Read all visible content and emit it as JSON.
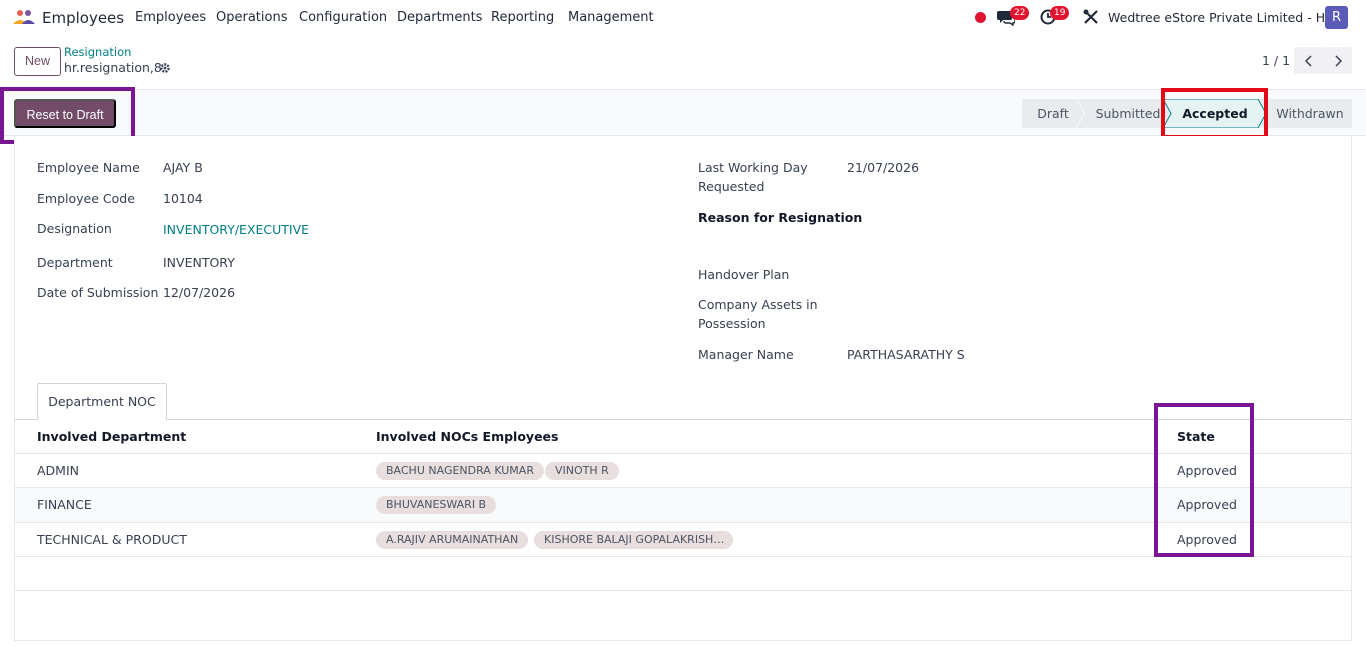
{
  "navbar": {
    "app_name": "Employees",
    "menus": [
      "Employees",
      "Operations",
      "Configuration",
      "Departments",
      "Reporting",
      "Management"
    ],
    "messages_count": "22",
    "activities_count": "19",
    "company": "Wedtree eStore Private Limited - HO",
    "avatar_letter": "R"
  },
  "control": {
    "new_label": "New",
    "breadcrumb_parent": "Resignation",
    "breadcrumb_current": "hr.resignation,8",
    "pager": "1 / 1"
  },
  "statusbar": {
    "reset_label": "Reset to Draft",
    "stages": [
      "Draft",
      "Submitted",
      "Accepted",
      "Withdrawn"
    ],
    "active_stage": "Accepted"
  },
  "form": {
    "left": [
      {
        "label": "Employee Name",
        "value": "AJAY B"
      },
      {
        "label": "Employee Code",
        "value": "10104"
      },
      {
        "label": "Designation",
        "value": "INVENTORY/EXECUTIVE"
      },
      {
        "label": "Department",
        "value": "INVENTORY"
      },
      {
        "label": "Date of Submission",
        "value": "12/07/2026"
      }
    ],
    "right": {
      "last_working_label_1": "Last Working Day",
      "last_working_label_2": "Requested",
      "last_working_value": "21/07/2026",
      "reason_label": "Reason for Resignation",
      "handover_label": "Handover Plan",
      "assets_label_1": "Company Assets in",
      "assets_label_2": "Possession",
      "manager_label": "Manager Name",
      "manager_value": "PARTHASARATHY S"
    }
  },
  "noc": {
    "tab_label": "Department NOC",
    "columns": [
      "Involved Department",
      "Involved NOCs Employees",
      "State"
    ],
    "rows": [
      {
        "department": "ADMIN",
        "employees": [
          "BACHU NAGENDRA KUMAR",
          "VINOTH R"
        ],
        "state": "Approved"
      },
      {
        "department": "FINANCE",
        "employees": [
          "BHUVANESWARI B"
        ],
        "state": "Approved"
      },
      {
        "department": "TECHNICAL & PRODUCT",
        "employees": [
          "A.RAJIV ARUMAINATHAN",
          "KISHORE BALAJI GOPALAKRISH…"
        ],
        "state": "Approved"
      }
    ]
  },
  "colors": {
    "primary": "#714b67",
    "link": "#017e84",
    "highlight_purple": "#7a1593",
    "highlight_red": "#e30a17"
  }
}
